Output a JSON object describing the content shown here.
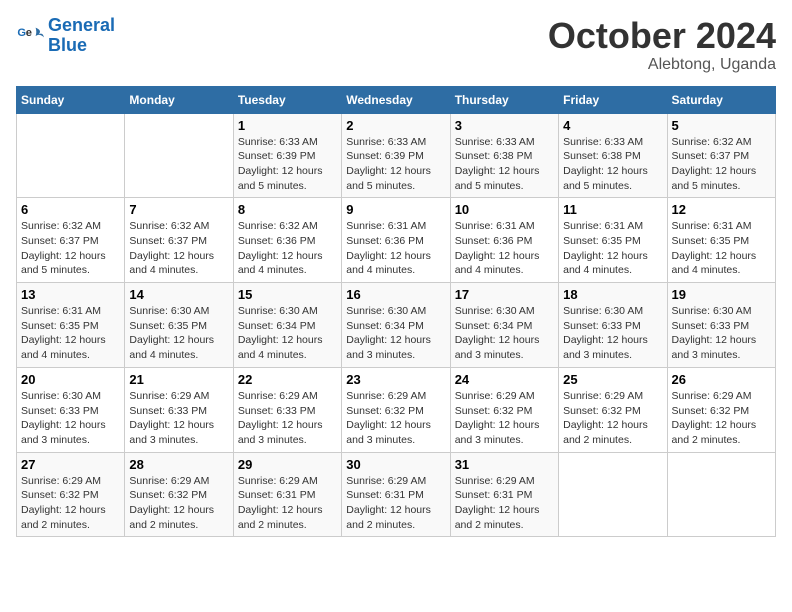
{
  "header": {
    "logo_line1": "General",
    "logo_line2": "Blue",
    "month": "October 2024",
    "location": "Alebtong, Uganda"
  },
  "weekdays": [
    "Sunday",
    "Monday",
    "Tuesday",
    "Wednesday",
    "Thursday",
    "Friday",
    "Saturday"
  ],
  "weeks": [
    [
      {
        "day": null,
        "detail": null
      },
      {
        "day": null,
        "detail": null
      },
      {
        "day": "1",
        "detail": "Sunrise: 6:33 AM\nSunset: 6:39 PM\nDaylight: 12 hours and 5 minutes."
      },
      {
        "day": "2",
        "detail": "Sunrise: 6:33 AM\nSunset: 6:39 PM\nDaylight: 12 hours and 5 minutes."
      },
      {
        "day": "3",
        "detail": "Sunrise: 6:33 AM\nSunset: 6:38 PM\nDaylight: 12 hours and 5 minutes."
      },
      {
        "day": "4",
        "detail": "Sunrise: 6:33 AM\nSunset: 6:38 PM\nDaylight: 12 hours and 5 minutes."
      },
      {
        "day": "5",
        "detail": "Sunrise: 6:32 AM\nSunset: 6:37 PM\nDaylight: 12 hours and 5 minutes."
      }
    ],
    [
      {
        "day": "6",
        "detail": "Sunrise: 6:32 AM\nSunset: 6:37 PM\nDaylight: 12 hours and 5 minutes."
      },
      {
        "day": "7",
        "detail": "Sunrise: 6:32 AM\nSunset: 6:37 PM\nDaylight: 12 hours and 4 minutes."
      },
      {
        "day": "8",
        "detail": "Sunrise: 6:32 AM\nSunset: 6:36 PM\nDaylight: 12 hours and 4 minutes."
      },
      {
        "day": "9",
        "detail": "Sunrise: 6:31 AM\nSunset: 6:36 PM\nDaylight: 12 hours and 4 minutes."
      },
      {
        "day": "10",
        "detail": "Sunrise: 6:31 AM\nSunset: 6:36 PM\nDaylight: 12 hours and 4 minutes."
      },
      {
        "day": "11",
        "detail": "Sunrise: 6:31 AM\nSunset: 6:35 PM\nDaylight: 12 hours and 4 minutes."
      },
      {
        "day": "12",
        "detail": "Sunrise: 6:31 AM\nSunset: 6:35 PM\nDaylight: 12 hours and 4 minutes."
      }
    ],
    [
      {
        "day": "13",
        "detail": "Sunrise: 6:31 AM\nSunset: 6:35 PM\nDaylight: 12 hours and 4 minutes."
      },
      {
        "day": "14",
        "detail": "Sunrise: 6:30 AM\nSunset: 6:35 PM\nDaylight: 12 hours and 4 minutes."
      },
      {
        "day": "15",
        "detail": "Sunrise: 6:30 AM\nSunset: 6:34 PM\nDaylight: 12 hours and 4 minutes."
      },
      {
        "day": "16",
        "detail": "Sunrise: 6:30 AM\nSunset: 6:34 PM\nDaylight: 12 hours and 3 minutes."
      },
      {
        "day": "17",
        "detail": "Sunrise: 6:30 AM\nSunset: 6:34 PM\nDaylight: 12 hours and 3 minutes."
      },
      {
        "day": "18",
        "detail": "Sunrise: 6:30 AM\nSunset: 6:33 PM\nDaylight: 12 hours and 3 minutes."
      },
      {
        "day": "19",
        "detail": "Sunrise: 6:30 AM\nSunset: 6:33 PM\nDaylight: 12 hours and 3 minutes."
      }
    ],
    [
      {
        "day": "20",
        "detail": "Sunrise: 6:30 AM\nSunset: 6:33 PM\nDaylight: 12 hours and 3 minutes."
      },
      {
        "day": "21",
        "detail": "Sunrise: 6:29 AM\nSunset: 6:33 PM\nDaylight: 12 hours and 3 minutes."
      },
      {
        "day": "22",
        "detail": "Sunrise: 6:29 AM\nSunset: 6:33 PM\nDaylight: 12 hours and 3 minutes."
      },
      {
        "day": "23",
        "detail": "Sunrise: 6:29 AM\nSunset: 6:32 PM\nDaylight: 12 hours and 3 minutes."
      },
      {
        "day": "24",
        "detail": "Sunrise: 6:29 AM\nSunset: 6:32 PM\nDaylight: 12 hours and 3 minutes."
      },
      {
        "day": "25",
        "detail": "Sunrise: 6:29 AM\nSunset: 6:32 PM\nDaylight: 12 hours and 2 minutes."
      },
      {
        "day": "26",
        "detail": "Sunrise: 6:29 AM\nSunset: 6:32 PM\nDaylight: 12 hours and 2 minutes."
      }
    ],
    [
      {
        "day": "27",
        "detail": "Sunrise: 6:29 AM\nSunset: 6:32 PM\nDaylight: 12 hours and 2 minutes."
      },
      {
        "day": "28",
        "detail": "Sunrise: 6:29 AM\nSunset: 6:32 PM\nDaylight: 12 hours and 2 minutes."
      },
      {
        "day": "29",
        "detail": "Sunrise: 6:29 AM\nSunset: 6:31 PM\nDaylight: 12 hours and 2 minutes."
      },
      {
        "day": "30",
        "detail": "Sunrise: 6:29 AM\nSunset: 6:31 PM\nDaylight: 12 hours and 2 minutes."
      },
      {
        "day": "31",
        "detail": "Sunrise: 6:29 AM\nSunset: 6:31 PM\nDaylight: 12 hours and 2 minutes."
      },
      {
        "day": null,
        "detail": null
      },
      {
        "day": null,
        "detail": null
      }
    ]
  ]
}
